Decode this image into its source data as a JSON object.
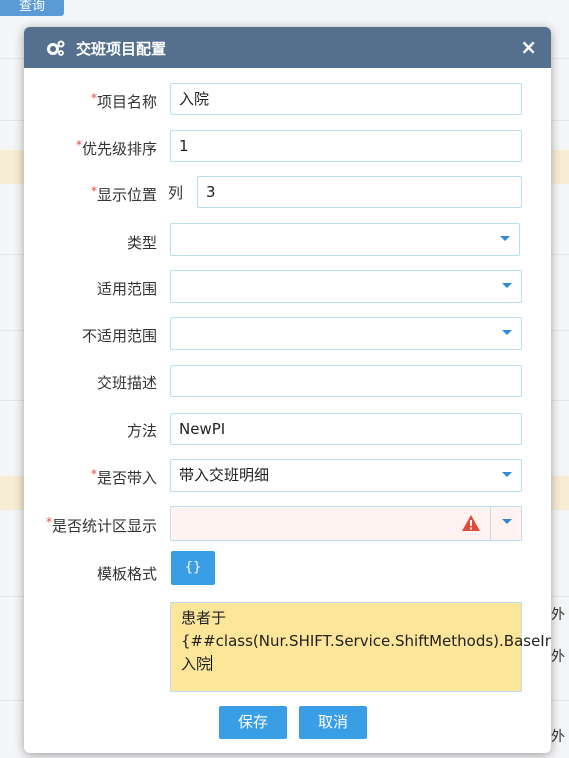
{
  "background": {
    "query_button": "查询",
    "side_cells": [
      "外",
      "外",
      "外"
    ]
  },
  "dialog": {
    "title": "交班项目配置",
    "close": "×",
    "required_mark": "*",
    "fields": {
      "name": {
        "label": "项目名称",
        "value": "入院",
        "required": true
      },
      "priority": {
        "label": "优先级排序",
        "value": "1",
        "required": true
      },
      "position": {
        "label": "显示位置",
        "prefix": "列",
        "value": "3",
        "required": true
      },
      "type": {
        "label": "类型",
        "value": ""
      },
      "scope": {
        "label": "适用范围",
        "value": ""
      },
      "exclude_scope": {
        "label": "不适用范围",
        "value": ""
      },
      "description": {
        "label": "交班描述",
        "value": ""
      },
      "method": {
        "label": "方法",
        "value": "NewPI"
      },
      "bring_in": {
        "label": "是否带入",
        "value": "带入交班明细",
        "required": true
      },
      "stat_display": {
        "label": "是否统计区显示",
        "value": "",
        "required": true
      },
      "template": {
        "label": "模板格式",
        "button": "{}",
        "value": "患者于{##class(Nur.SHIFT.Service.ShiftMethods).BaseInfo(\"RYSJ\")}入院"
      }
    },
    "buttons": {
      "save": "保存",
      "cancel": "取消"
    }
  },
  "colors": {
    "header": "#556f8e",
    "primary": "#3a9ee6",
    "required": "#e04a3b",
    "template_bg": "#fde59a"
  }
}
